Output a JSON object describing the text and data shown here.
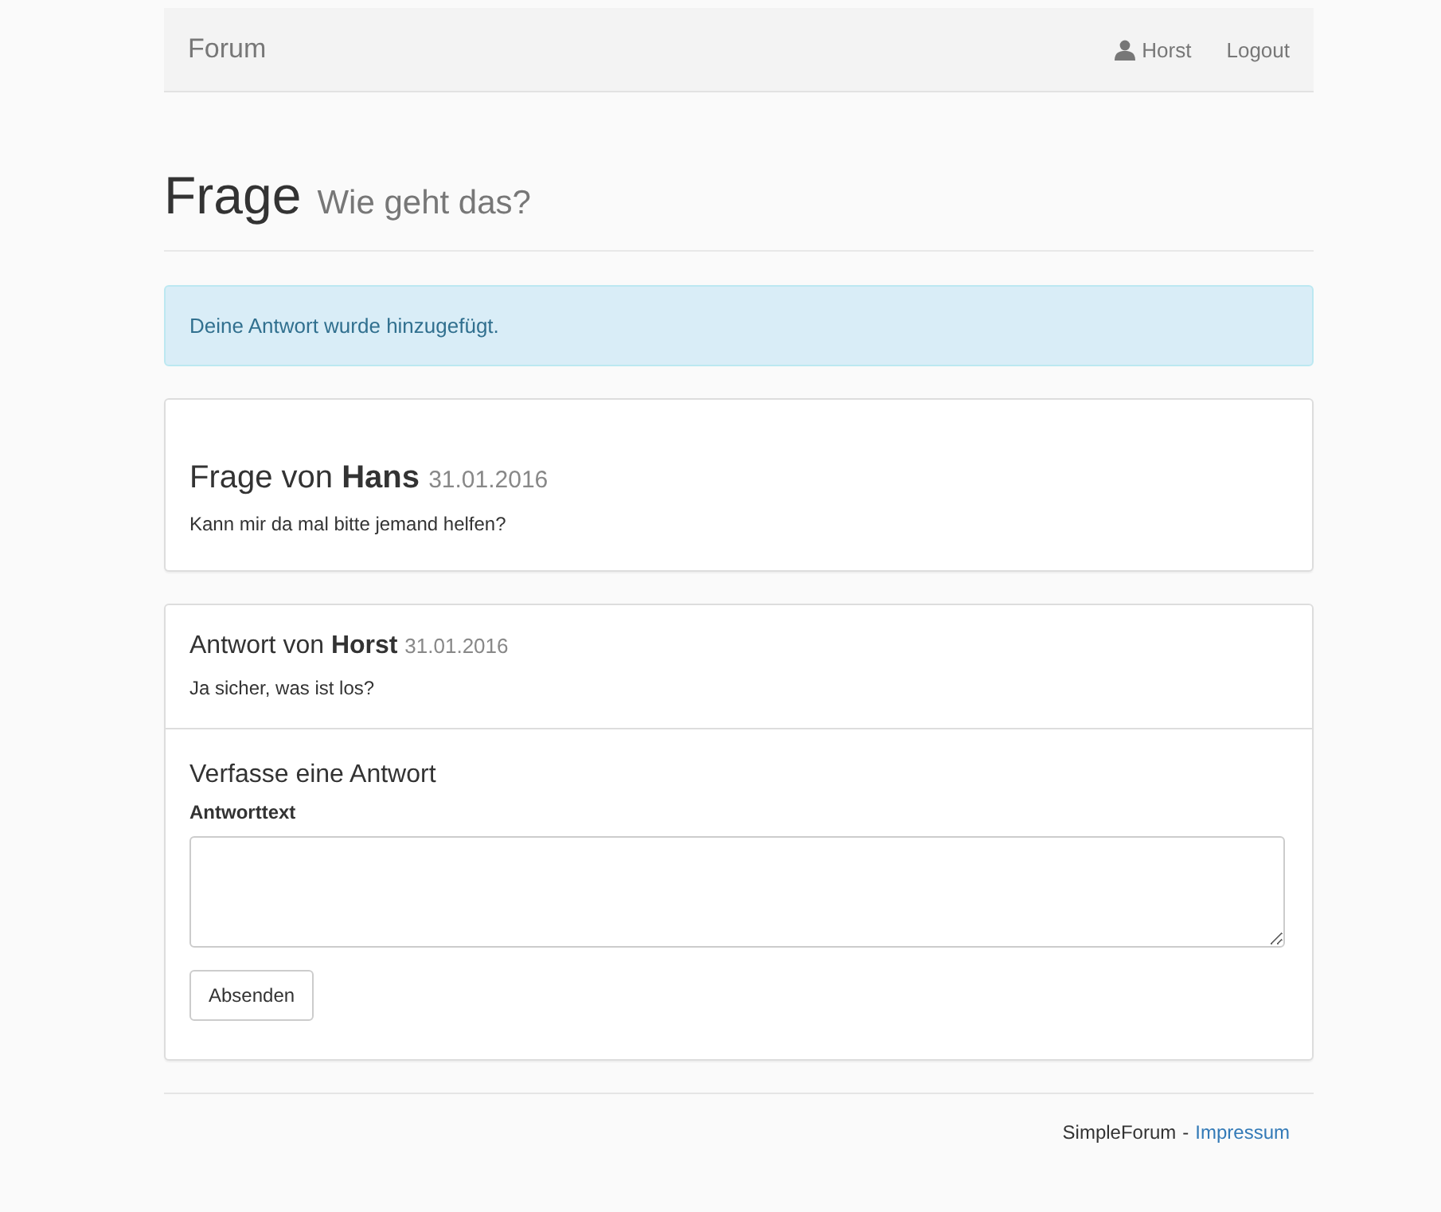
{
  "navbar": {
    "brand": "Forum",
    "user": "Horst",
    "logout": "Logout"
  },
  "header": {
    "title": "Frage",
    "subtitle": "Wie geht das?"
  },
  "alert": {
    "message": "Deine Antwort wurde hinzugefügt."
  },
  "question": {
    "prefix": "Frage von",
    "author": "Hans",
    "date": "31.01.2016",
    "text": "Kann mir da mal bitte jemand helfen?"
  },
  "answers": [
    {
      "prefix": "Antwort von",
      "author": "Horst",
      "date": "31.01.2016",
      "text": "Ja sicher, was ist los?"
    }
  ],
  "reply_form": {
    "heading": "Verfasse eine Antwort",
    "label": "Antworttext",
    "submit": "Absenden"
  },
  "footer": {
    "brand": "SimpleForum",
    "separator": "-",
    "link": "Impressum"
  }
}
